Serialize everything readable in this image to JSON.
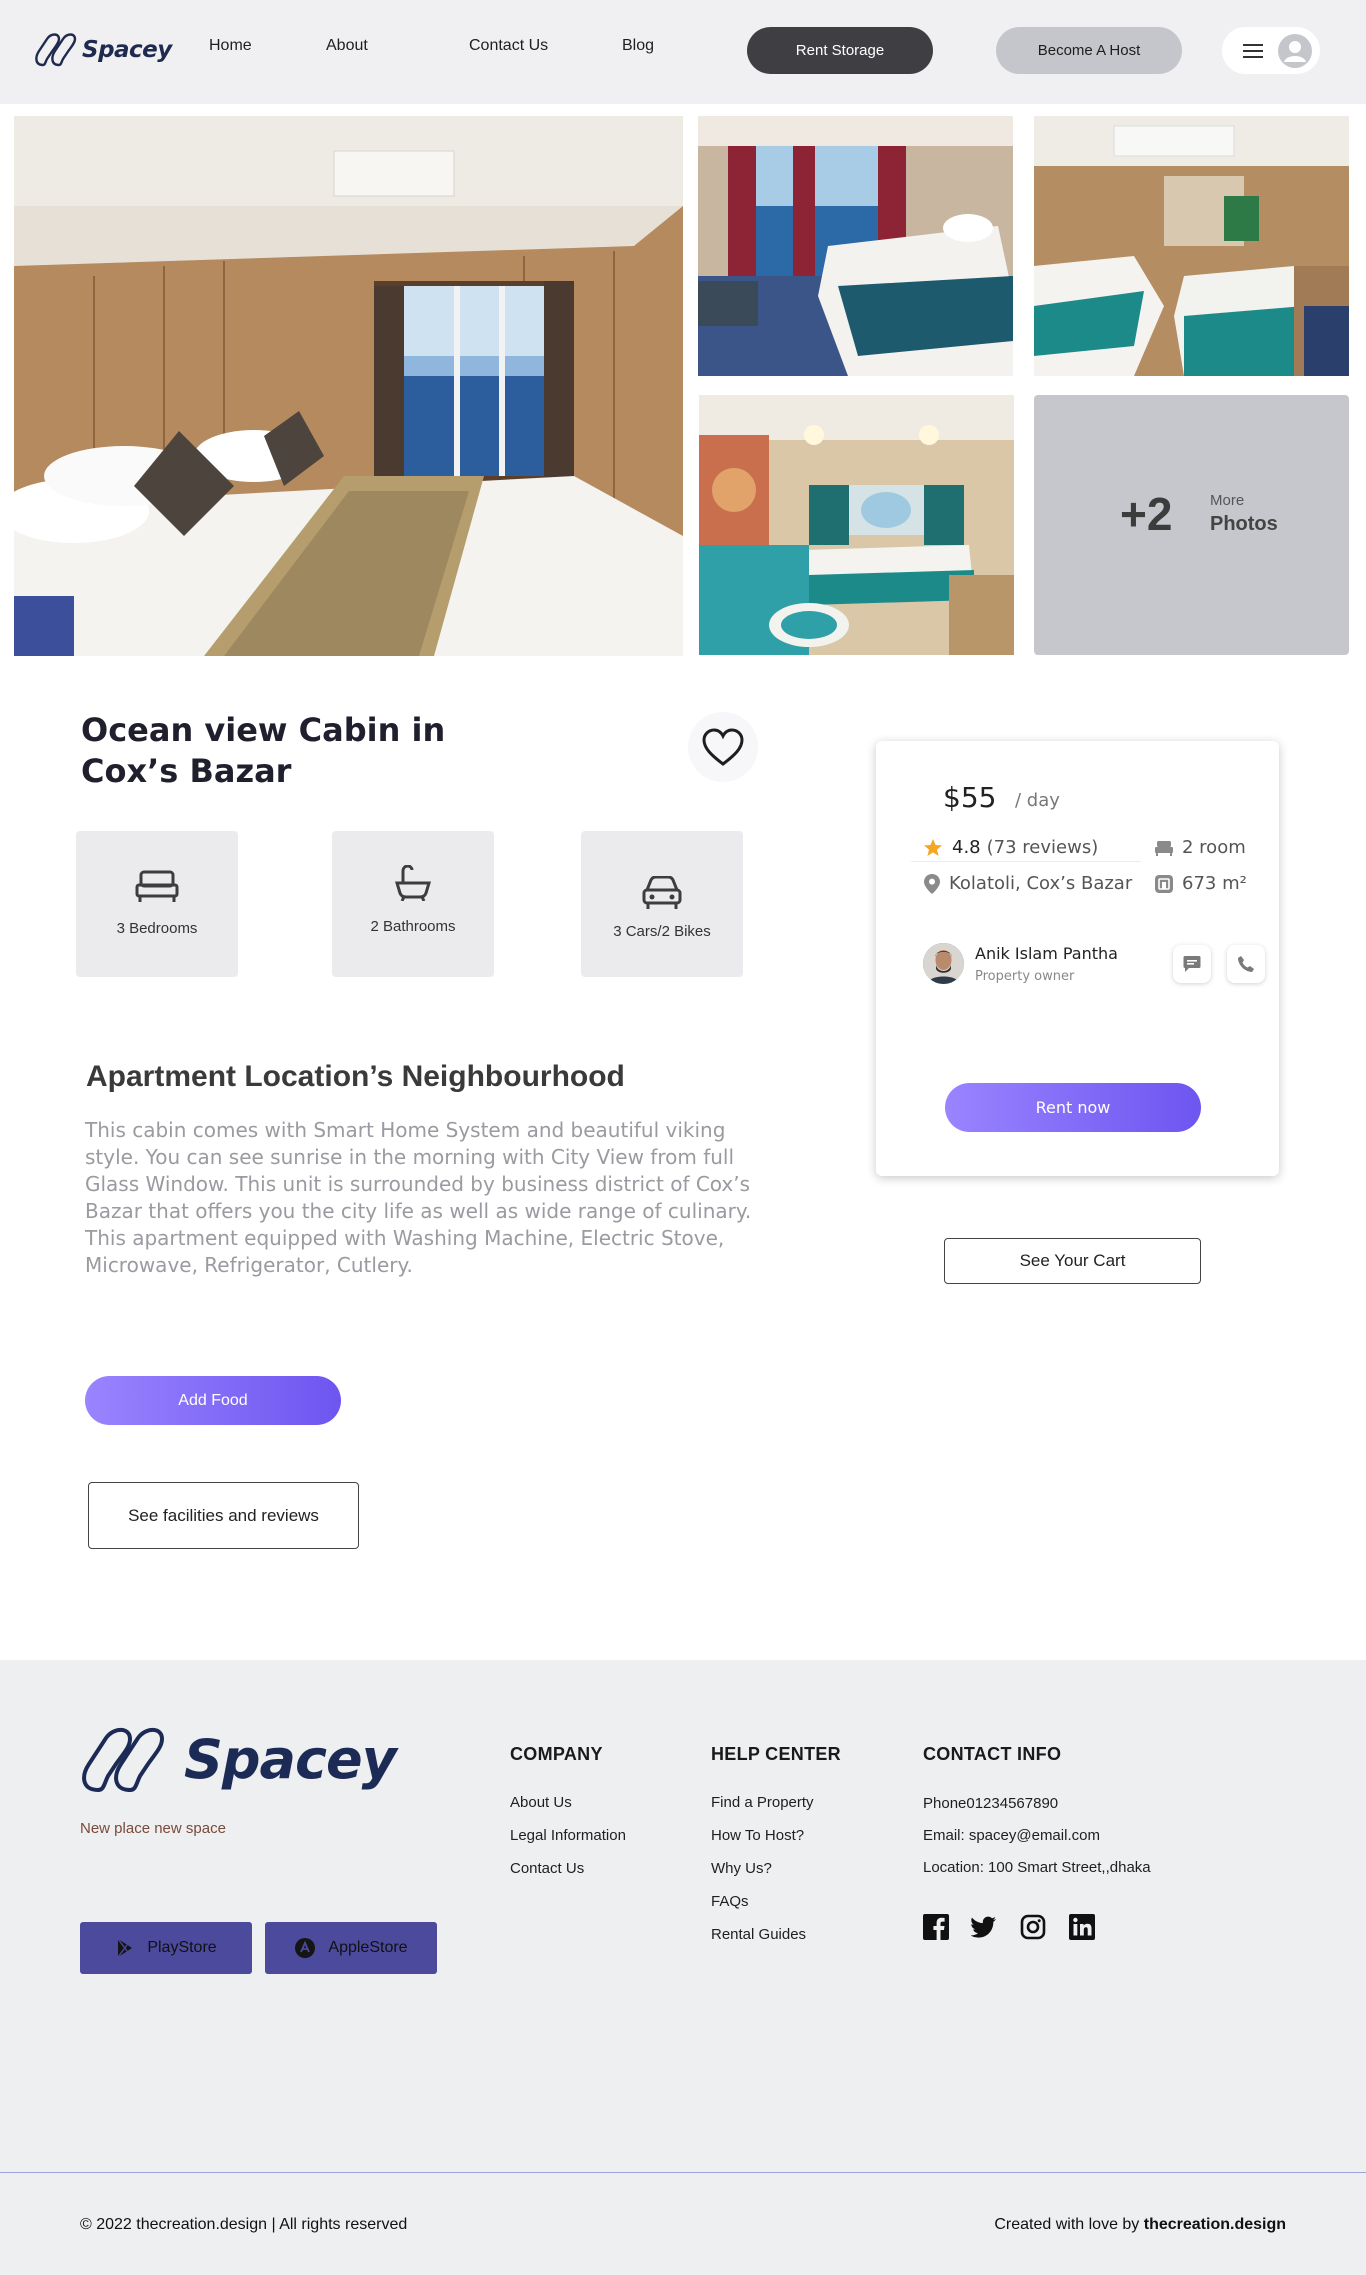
{
  "header": {
    "logo_text": "Spacey",
    "nav": [
      "Home",
      "About",
      "Contact Us",
      "Blog"
    ],
    "rent_storage_label": "Rent Storage",
    "become_host_label": "Become A Host"
  },
  "gallery": {
    "more_count": "+2",
    "more_label": "More",
    "more_sub": "Photos"
  },
  "listing": {
    "title": "Ocean view Cabin in Cox’s Bazar",
    "features": [
      "3 Bedrooms",
      "2 Bathrooms",
      "3 Cars/2 Bikes"
    ],
    "neighbourhood_heading": "Apartment Location’s Neighbourhood",
    "description": "This cabin comes with Smart Home System and beautiful viking style. You can see sunrise in the morning with City View from full Glass Window. This unit is surrounded by business district of Cox’s Bazar that offers you the city life as well as wide range of culinary. This apartment equipped with Washing Machine, Electric Stove, Microwave, Refrigerator, Cutlery.",
    "add_food_label": "Add Food",
    "facilities_label": "See facilities and reviews"
  },
  "booking": {
    "price": "$55",
    "price_unit": "/ day",
    "rating": "4.8",
    "reviews": "(73 reviews)",
    "rooms": "2 room",
    "location": "Kolatoli, Cox’s Bazar",
    "area": "673 m²",
    "owner_name": "Anik Islam Pantha",
    "owner_role": "Property owner",
    "rent_now_label": "Rent now",
    "cart_label": "See Your Cart"
  },
  "footer": {
    "logo_text": "Spacey",
    "tagline": "New place new  space",
    "playstore_label": "PlayStore",
    "applestore_label": "AppleStore",
    "company_title": "COMPANY",
    "company_links": [
      "About Us",
      "Legal Information",
      "Contact Us"
    ],
    "help_title": "HELP CENTER",
    "help_links": [
      "Find a Property",
      "How To Host?",
      "Why Us?",
      "FAQs",
      "Rental Guides"
    ],
    "contact_title": "CONTACT INFO",
    "contact_lines": [
      "Phone01234567890",
      "Email: spacey@email.com",
      "Location: 100 Smart Street,,dhaka"
    ],
    "copyright": "© 2022 thecreation.design | All rights reserved",
    "credit_prefix": "Created with love by ",
    "credit_brand": "thecreation.design"
  },
  "colors": {
    "accent_purple": "#7b65f5",
    "dark_button": "#3f3f43",
    "header_bg": "#f0f0f2",
    "star": "#f5a623"
  },
  "icons": [
    "logo-mark-icon",
    "menu-icon",
    "user-icon",
    "heart-icon",
    "bed-icon",
    "bathtub-icon",
    "car-icon",
    "star-icon",
    "location-pin-icon",
    "room-bed-icon",
    "area-icon",
    "chat-icon",
    "phone-icon",
    "play-store-icon",
    "apple-store-icon",
    "facebook-icon",
    "twitter-icon",
    "instagram-icon",
    "linkedin-icon"
  ]
}
